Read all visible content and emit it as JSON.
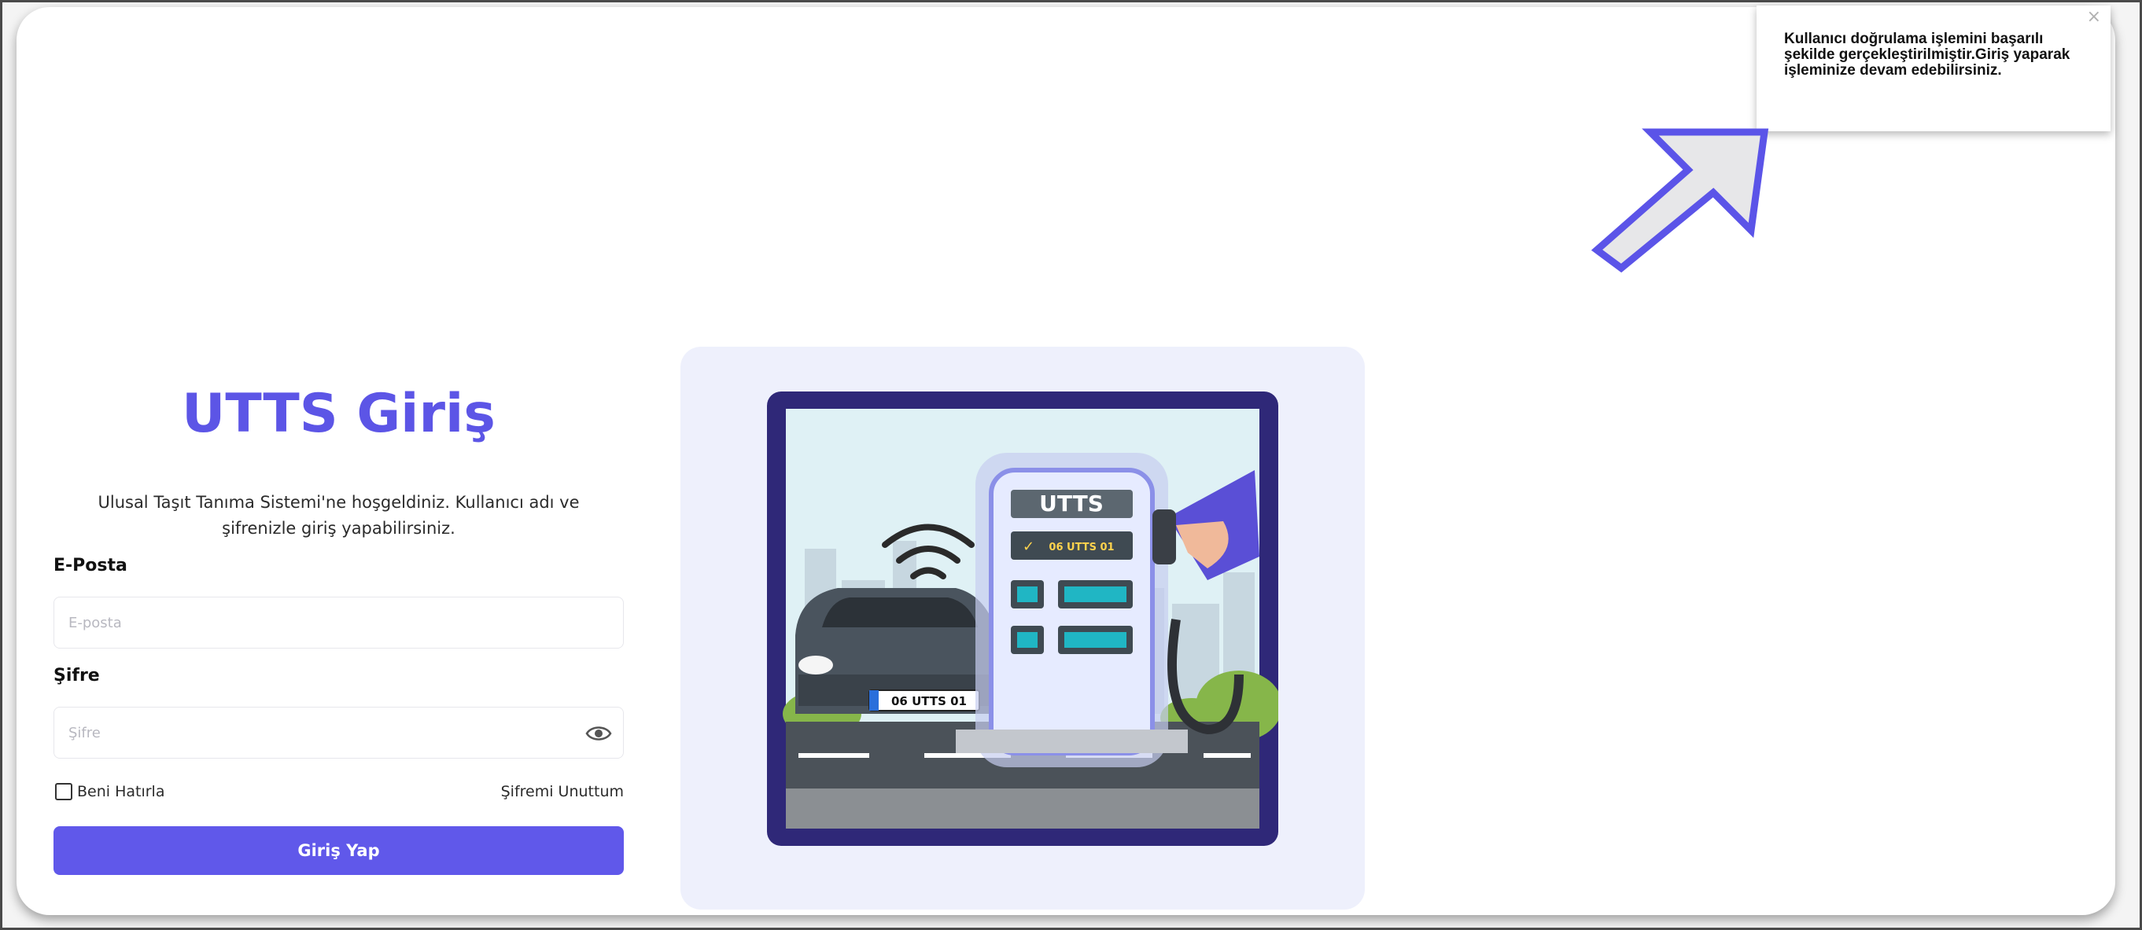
{
  "login": {
    "title": "UTTS Giriş",
    "subtitle": "Ulusal Taşıt Tanıma Sistemi'ne hoşgeldiniz. Kullanıcı adı ve şifrenizle giriş yapabilirsiniz.",
    "email_label": "E-Posta",
    "email_placeholder": "E-posta",
    "email_value": "",
    "password_label": "Şifre",
    "password_placeholder": "Şifre",
    "password_value": "",
    "remember_label": "Beni Hatırla",
    "remember_checked": false,
    "forgot_label": "Şifremi Unuttum",
    "submit_label": "Giriş Yap"
  },
  "illustration": {
    "pump_label": "UTTS",
    "pump_plate": "06 UTTS 01",
    "car_plate": "06 UTTS 01"
  },
  "toast": {
    "message": "Kullanıcı doğrulama işlemini başarılı şekilde gerçekleştirilmiştir.Giriş yaparak işleminize devam edebilirsiniz.",
    "close_symbol": "×"
  },
  "icons": {
    "password_toggle": "eye-icon",
    "toast_close": "close-icon",
    "annotation": "arrow-icon"
  },
  "colors": {
    "primary": "#6058ea",
    "title": "#5c55e6",
    "illustration_bg": "#eef0fc",
    "annotation_arrow": "#5b54e8"
  }
}
